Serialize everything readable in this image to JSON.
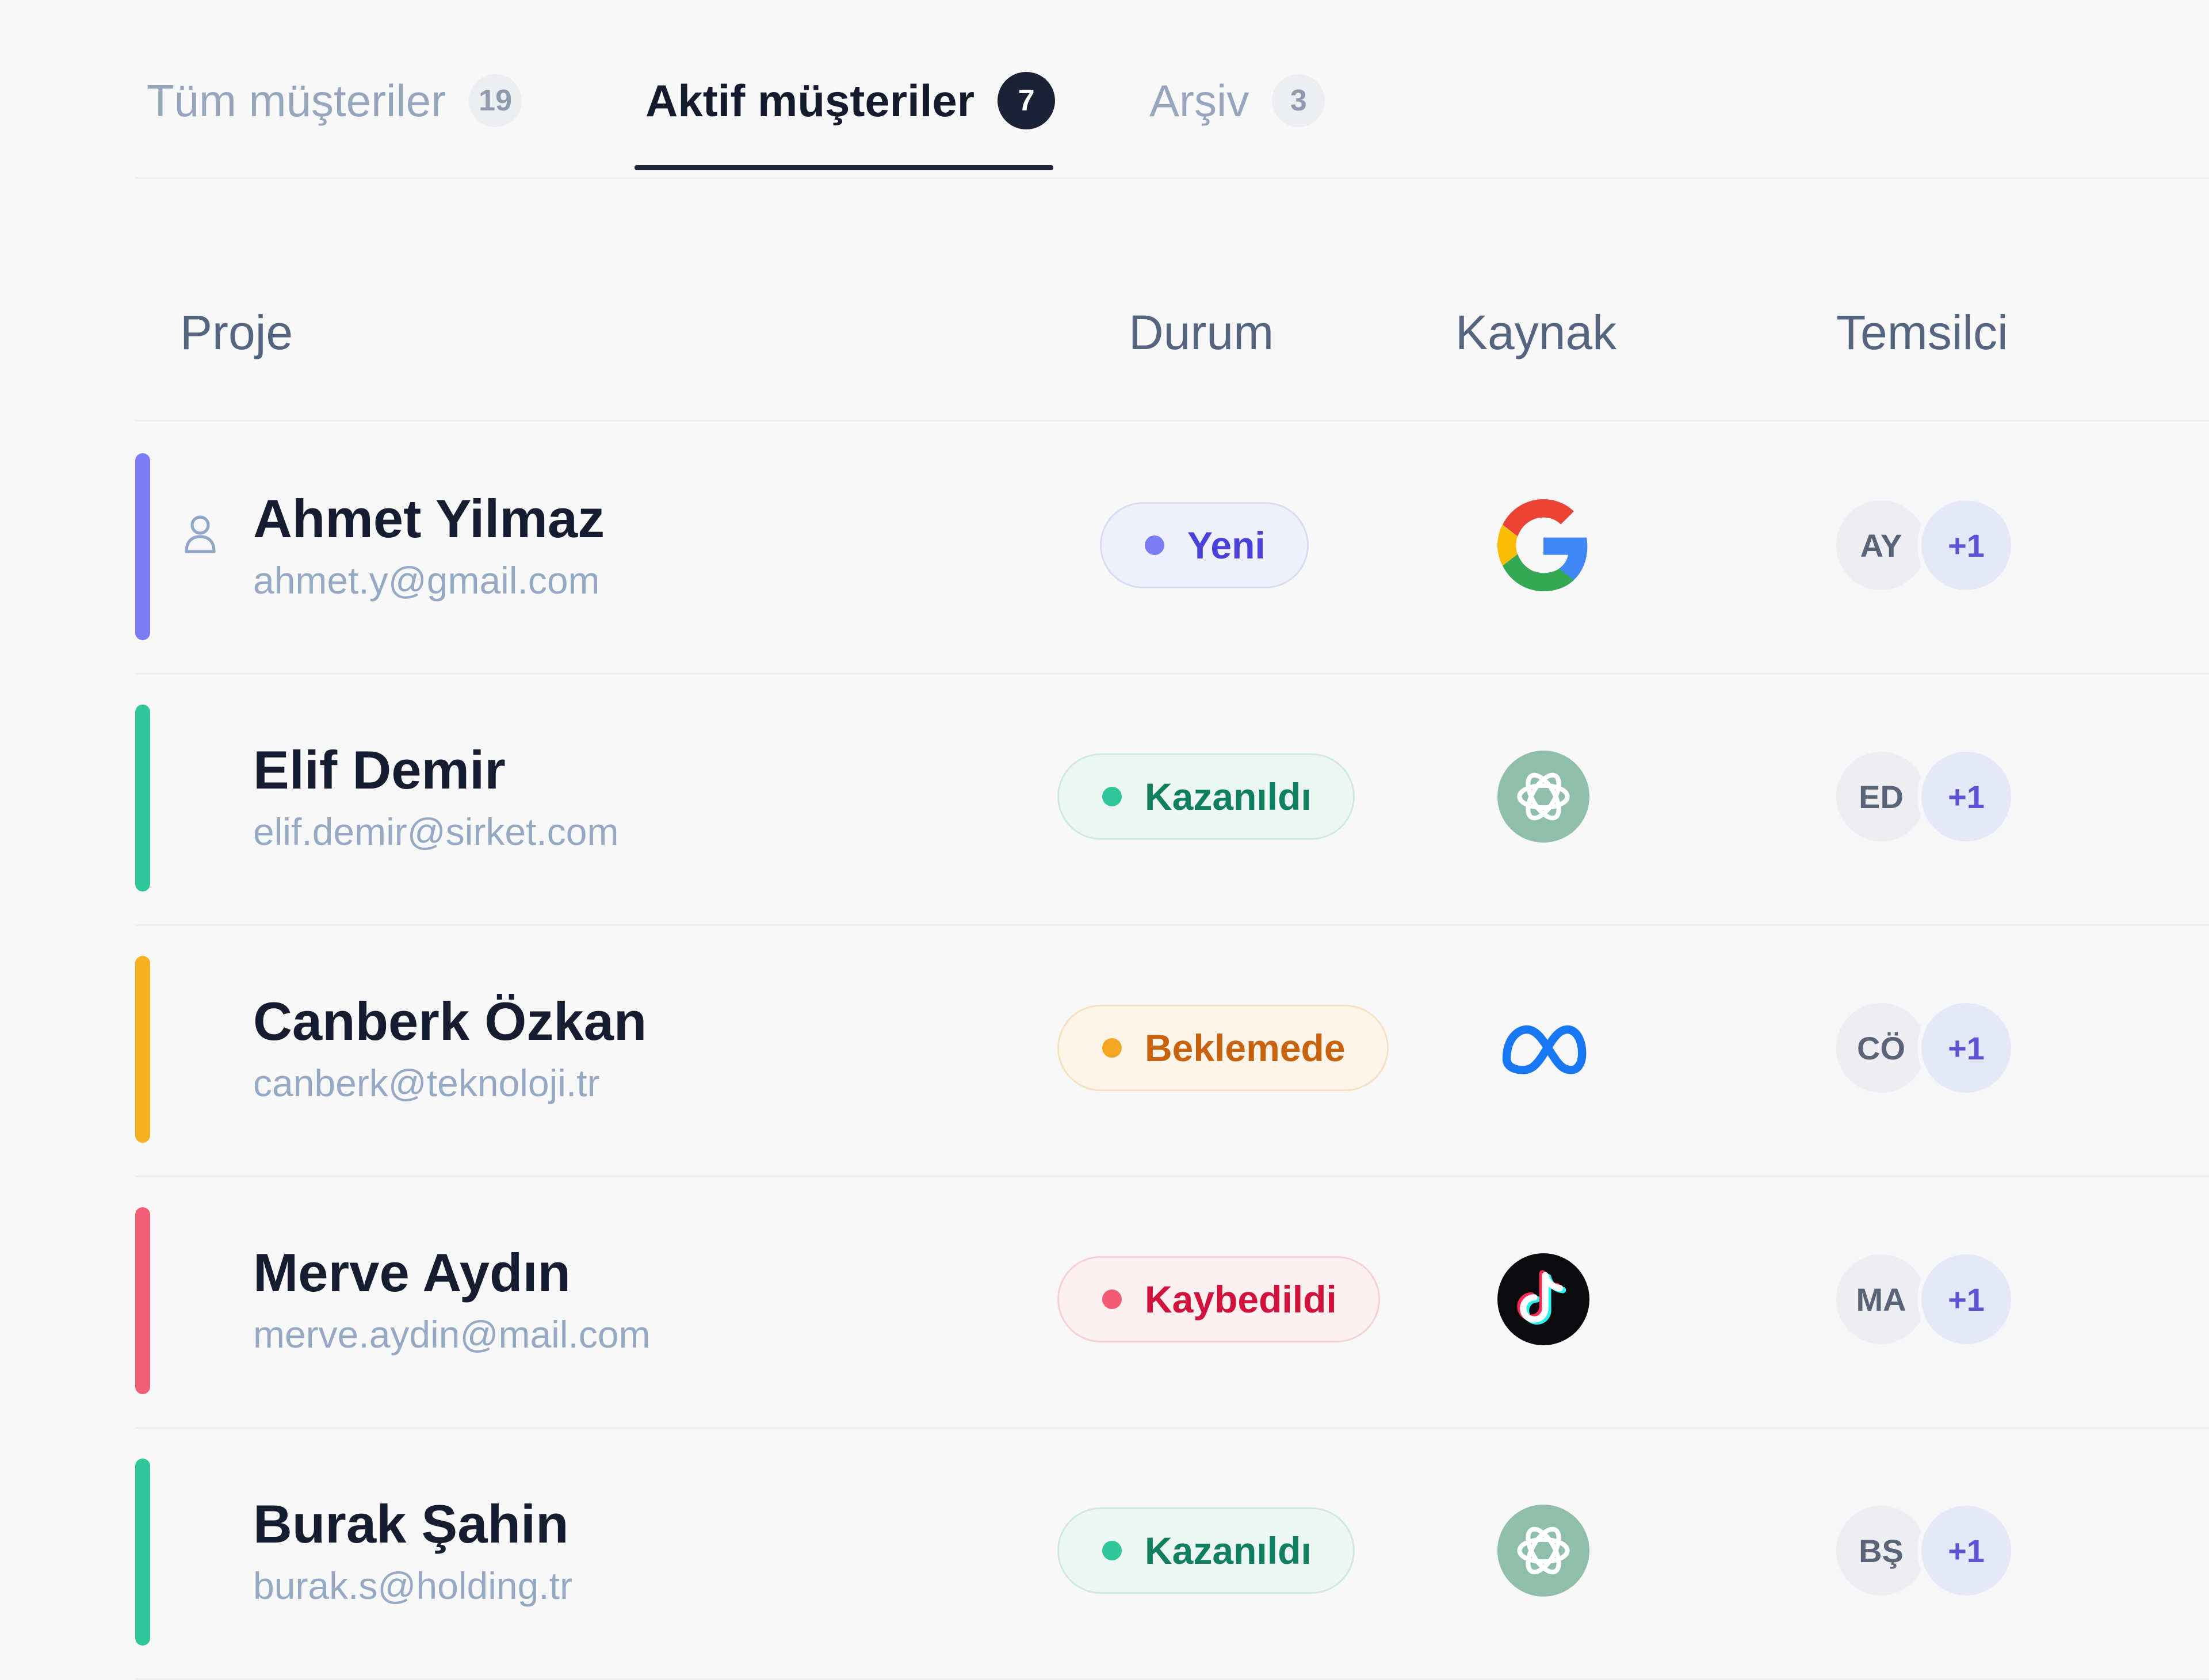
{
  "tabs": [
    {
      "label": "Tüm müşteriler",
      "count": "19",
      "active": false
    },
    {
      "label": "Aktif müşteriler",
      "count": "7",
      "active": true
    },
    {
      "label": "Arşiv",
      "count": "3",
      "active": false
    }
  ],
  "table": {
    "headers": {
      "project": "Proje",
      "status": "Durum",
      "source": "Kaynak",
      "rep": "Temsilci"
    },
    "rows": [
      {
        "name": "Ahmet Yilmaz",
        "email": "ahmet.y@gmail.com",
        "status": "Yeni",
        "source": "google-logo-icon",
        "initials": "AY",
        "extra": "+1",
        "accent": "#7b7cf4"
      },
      {
        "name": "Elif Demir",
        "email": "elif.demir@sirket.com",
        "status": "Kazanıldı",
        "source": "openai-logo-icon",
        "initials": "ED",
        "extra": "+1",
        "accent": "#2fc79a"
      },
      {
        "name": "Canberk Özkan",
        "email": "canberk@teknoloji.tr",
        "status": "Beklemede",
        "source": "meta-logo-icon",
        "initials": "CÖ",
        "extra": "+1",
        "accent": "#f5b120"
      },
      {
        "name": "Merve Aydın",
        "email": "merve.aydin@mail.com",
        "status": "Kaybedildi",
        "source": "tiktok-logo-icon",
        "initials": "MA",
        "extra": "+1",
        "accent": "#f25d78"
      },
      {
        "name": "Burak Şahin",
        "email": "burak.s@holding.tr",
        "status": "Kazanıldı",
        "source": "openai-logo-icon",
        "initials": "BŞ",
        "extra": "+1",
        "accent": "#2fc79a"
      }
    ]
  },
  "status_colors": {
    "Yeni": {
      "text": "#4a42d8",
      "dot": "#7b7cf4",
      "bg": "#eef0fb",
      "border": "#d8dcf3"
    },
    "Kazanıldı": {
      "text": "#0f7f60",
      "dot": "#2fc79a",
      "bg": "#ecf7f3",
      "border": "#cfe9df"
    },
    "Beklemede": {
      "text": "#c8620e",
      "dot": "#f2a621",
      "bg": "#fdf5ea",
      "border": "#f7e1bf"
    },
    "Kaybedildi": {
      "text": "#d0123c",
      "dot": "#f35c77",
      "bg": "#fcf0f1",
      "border": "#f6d0d6"
    }
  }
}
